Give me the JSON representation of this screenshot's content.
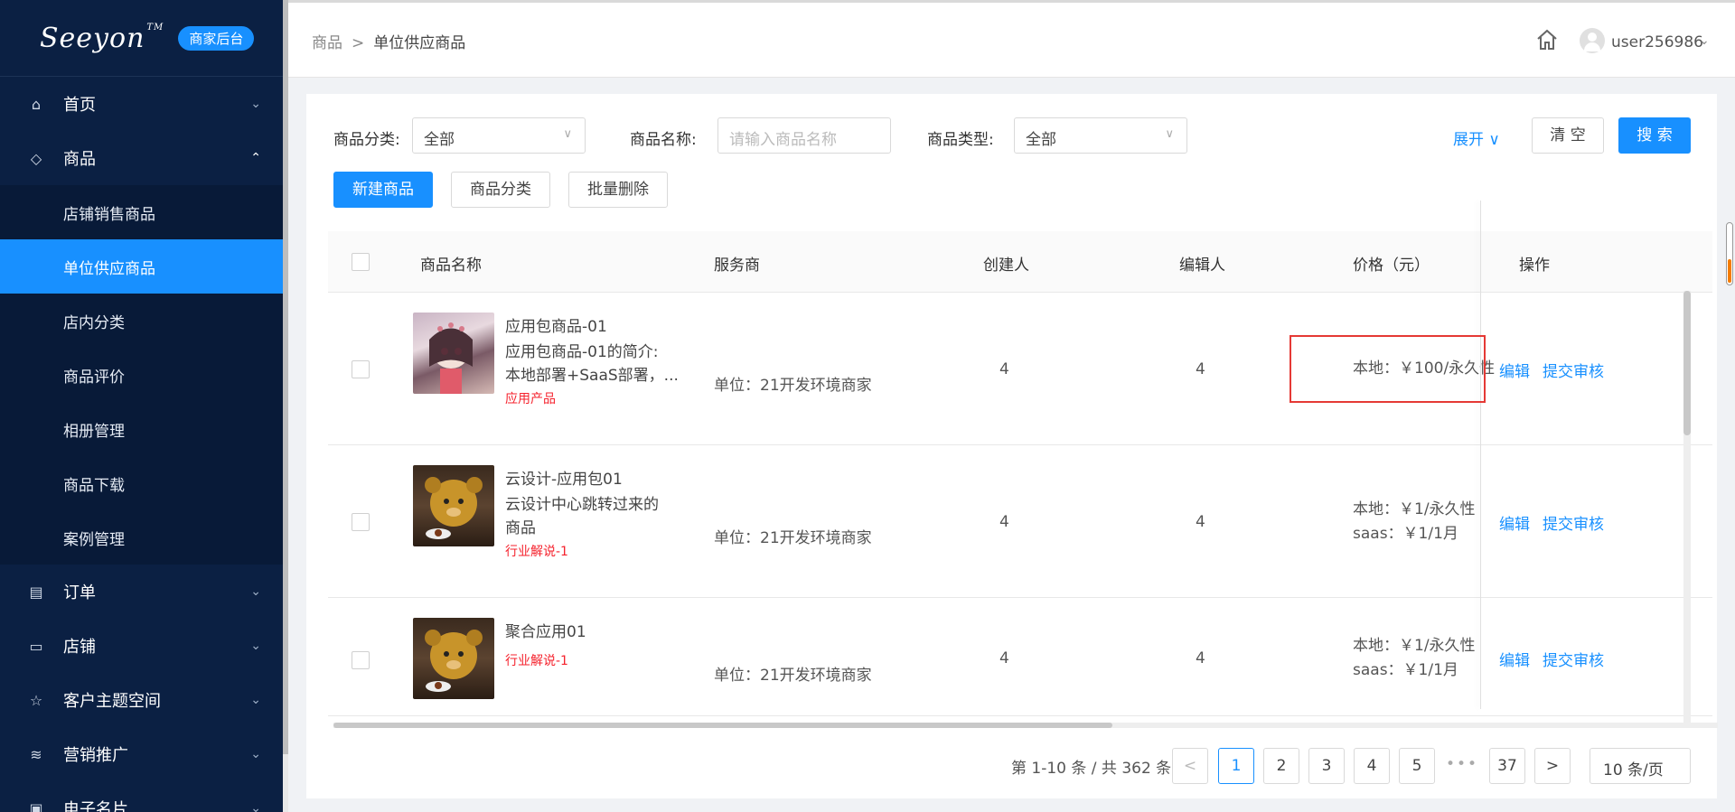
{
  "sidebar": {
    "logo": "Seeyon",
    "badge": "商家后台",
    "menu": [
      {
        "label": "首页"
      },
      {
        "label": "商品"
      },
      {
        "label": "订单"
      },
      {
        "label": "店铺"
      },
      {
        "label": "客户主题空间"
      },
      {
        "label": "营销推广"
      },
      {
        "label": "电子名片"
      }
    ],
    "submenu": [
      "店铺销售商品",
      "单位供应商品",
      "店内分类",
      "商品评价",
      "相册管理",
      "商品下载",
      "案例管理"
    ]
  },
  "header": {
    "breadcrumb": [
      "商品",
      "单位供应商品"
    ],
    "separator": ">",
    "username": "user256986"
  },
  "filters": {
    "category_label": "商品分类:",
    "category_value": "全部",
    "name_label": "商品名称:",
    "name_placeholder": "请输入商品名称",
    "type_label": "商品类型:",
    "type_value": "全部",
    "expand": "展开",
    "clear": "清 空",
    "search": "搜 索"
  },
  "actions": {
    "new": "新建商品",
    "category": "商品分类",
    "batch_delete": "批量删除"
  },
  "table": {
    "columns": [
      "商品名称",
      "服务商",
      "创建人",
      "编辑人",
      "价格（元）",
      "操作"
    ],
    "rows": [
      {
        "title": "应用包商品-01",
        "desc1": "应用包商品-01的简介:",
        "desc2": "本地部署+SaaS部署，...",
        "tag": "应用产品",
        "provider": "单位：21开发环境商家",
        "creator": "4",
        "editor": "4",
        "price1": "本地：￥100/永久性",
        "price2": "",
        "edit": "编辑",
        "submit": "提交审核"
      },
      {
        "title": "云设计-应用包01",
        "desc1": "云设计中心跳转过来的",
        "desc2": "商品",
        "tag": "行业解说-1",
        "provider": "单位：21开发环境商家",
        "creator": "4",
        "editor": "4",
        "price1": "本地：￥1/永久性",
        "price2": "saas：￥1/1月",
        "edit": "编辑",
        "submit": "提交审核"
      },
      {
        "title": "聚合应用01",
        "desc1": "",
        "desc2": "",
        "tag": "行业解说-1",
        "provider": "单位：21开发环境商家",
        "creator": "4",
        "editor": "4",
        "price1": "本地：￥1/永久性",
        "price2": "saas：￥1/1月",
        "edit": "编辑",
        "submit": "提交审核"
      }
    ]
  },
  "pagination": {
    "total_text": "第 1-10 条 / 共 362 条",
    "pages": [
      "1",
      "2",
      "3",
      "4",
      "5"
    ],
    "ellipsis": "•••",
    "last": "37",
    "page_size": "10 条/页"
  },
  "colors": {
    "sidebar_bg": "#0b2043",
    "accent": "#1890ff",
    "tag_red": "#f5222d",
    "highlight_border": "#e53935"
  }
}
